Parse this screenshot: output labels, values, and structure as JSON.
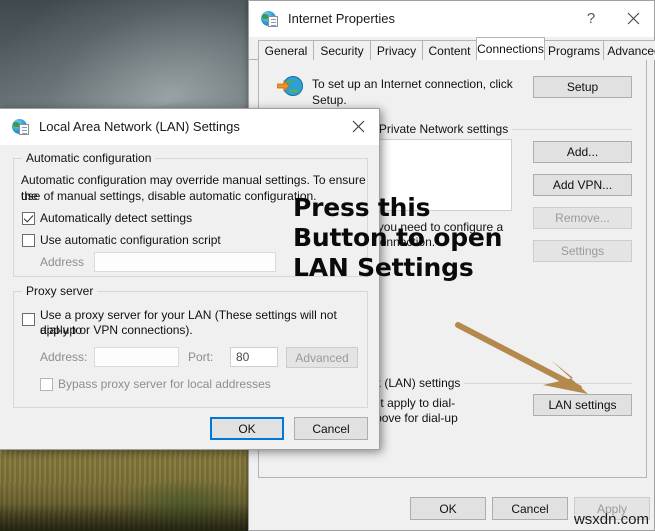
{
  "desktop": {
    "name": "desktop-wallpaper-storm-clouds-over-field"
  },
  "internet_properties": {
    "title": "Internet Properties",
    "icon": "globe-page-icon",
    "help_label": "?",
    "close_label": "✕",
    "tabs": [
      {
        "label": "General",
        "active": false
      },
      {
        "label": "Security",
        "active": false
      },
      {
        "label": "Privacy",
        "active": false
      },
      {
        "label": "Content",
        "active": false
      },
      {
        "label": "Connections",
        "active": true
      },
      {
        "label": "Programs",
        "active": false
      },
      {
        "label": "Advanced",
        "active": false
      }
    ],
    "setup": {
      "icon": "globe-with-orange-arrow-icon",
      "text": "To set up an Internet connection, click Setup.",
      "button": "Setup"
    },
    "vpn_group": {
      "label": "Dial-up and Virtual Private Network settings",
      "visible_label": "ate Network settings",
      "buttons": [
        {
          "label": "Add...",
          "enabled": true
        },
        {
          "label": "Add VPN...",
          "enabled": true
        },
        {
          "label": "Remove...",
          "enabled": false
        },
        {
          "label": "Settings",
          "enabled": false
        }
      ],
      "hint": "Choose Settings if you need to configure a proxy server for a connection."
    },
    "lan_group": {
      "label": "Local Area Network (LAN) settings",
      "visible_label": "AN) settings",
      "text_line1": "LAN Settings do not apply to dial-up connections.",
      "text_line2": "Choose Settings above for dial-up settings.",
      "visible_line1": "apply to dial-up connections.",
      "visible_line2": "ve for dial-up settings.",
      "button": "LAN settings"
    },
    "footer": {
      "ok": "OK",
      "cancel": "Cancel",
      "apply": "Apply",
      "apply_enabled": false
    }
  },
  "lan_settings": {
    "title": "Local Area Network (LAN) Settings",
    "icon": "globe-page-icon",
    "close_label": "✕",
    "automatic_configuration": {
      "group_label": "Automatic configuration",
      "description_line1": "Automatic configuration may override manual settings.  To ensure the",
      "description_line2": "use of manual settings, disable automatic configuration.",
      "auto_detect": {
        "label": "Automatically detect settings",
        "checked": true
      },
      "use_script": {
        "label": "Use automatic configuration script",
        "checked": false
      },
      "address_label": "Address",
      "address_value": "",
      "address_enabled": false
    },
    "proxy_server": {
      "group_label": "Proxy server",
      "use_proxy": {
        "label_line1": "Use a proxy server for your LAN (These settings will not apply to",
        "label_line2": "dial-up or VPN connections).",
        "checked": false
      },
      "address_label": "Address:",
      "address_value": "",
      "port_label": "Port:",
      "port_value": "80",
      "advanced_button": "Advanced",
      "advanced_enabled": false,
      "bypass": {
        "label": "Bypass proxy server for local addresses",
        "checked": false
      }
    },
    "footer": {
      "ok": "OK",
      "cancel": "Cancel"
    }
  },
  "annotation": {
    "line1": "Press this",
    "line2": "Button to open",
    "line3": "LAN Settings",
    "arrow_color": "#b4894e",
    "arrow_name": "pointer-arrow-to-lan-settings"
  },
  "watermark": {
    "text": "wsxdn.com"
  }
}
